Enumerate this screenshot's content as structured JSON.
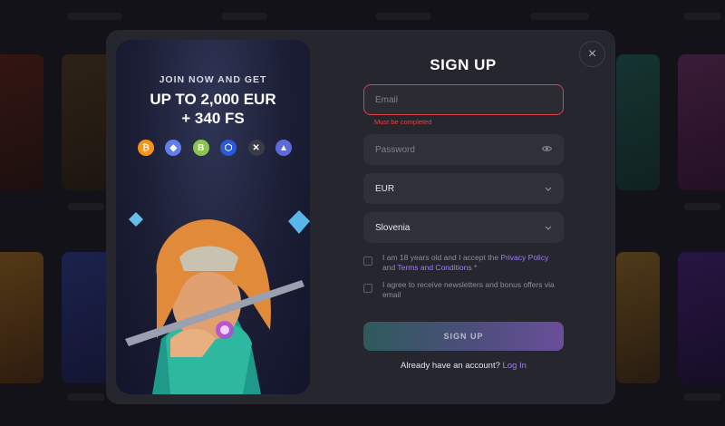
{
  "promo": {
    "kicker": "JOIN NOW AND GET",
    "headline_line1": "UP TO 2,000 EUR",
    "headline_line2": "+ 340 FS",
    "coins": [
      {
        "icon": "bitcoin-icon",
        "glyph": "₿",
        "color": "#f7931a"
      },
      {
        "icon": "ethereum-icon",
        "glyph": "◆",
        "color": "#627eea"
      },
      {
        "icon": "bitcoin-cash-icon",
        "glyph": "B",
        "color": "#8dc351"
      },
      {
        "icon": "chainlink-icon",
        "glyph": "⬡",
        "color": "#2a5ada"
      },
      {
        "icon": "xrp-icon",
        "glyph": "✕",
        "color": "#3a3b45"
      },
      {
        "icon": "tron-icon",
        "glyph": "▲",
        "color": "#5c6bd8"
      }
    ]
  },
  "form": {
    "title": "SIGN UP",
    "email_placeholder": "Email",
    "email_error": "Must be completed",
    "password_placeholder": "Password",
    "currency": "EUR",
    "country": "Slovenia",
    "terms_prefix": "I am 18 years old and I accept the ",
    "terms_privacy_link": "Privacy Policy",
    "terms_and": " and ",
    "terms_conditions_link": "Terms and Conditions",
    "terms_required": " *",
    "newsletter": "I agree to receive newsletters and bonus offers via email",
    "submit_label": "SIGN UP",
    "login_prompt": "Already have an account? ",
    "login_link": "Log In"
  },
  "colors": {
    "accent": "#a07bff",
    "error": "#d9424a",
    "modal_bg": "#26272e"
  }
}
